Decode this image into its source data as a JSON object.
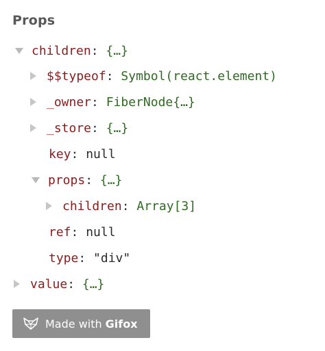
{
  "panel": {
    "title": "Props"
  },
  "tree": [
    {
      "id": "children",
      "key": "children",
      "value": "{…}",
      "vtype": "obj",
      "expander": "expanded"
    },
    {
      "id": "typeof",
      "key": "$$typeof",
      "value": "Symbol(react.element)",
      "vtype": "fn",
      "expander": "collapsed"
    },
    {
      "id": "owner",
      "key": "_owner",
      "value": "FiberNode{…}",
      "vtype": "fn",
      "expander": "collapsed"
    },
    {
      "id": "store",
      "key": "_store",
      "value": "{…}",
      "vtype": "obj",
      "expander": "collapsed"
    },
    {
      "id": "key",
      "key": "key",
      "value": "null",
      "vtype": "val",
      "expander": "none"
    },
    {
      "id": "props",
      "key": "props",
      "value": "{…}",
      "vtype": "obj",
      "expander": "expanded"
    },
    {
      "id": "props-children",
      "key": "children",
      "value": "Array[3]",
      "vtype": "fn",
      "expander": "collapsed"
    },
    {
      "id": "ref",
      "key": "ref",
      "value": "null",
      "vtype": "val",
      "expander": "none"
    },
    {
      "id": "type",
      "key": "type",
      "value": "\"div\"",
      "vtype": "val",
      "expander": "none"
    },
    {
      "id": "value",
      "key": "value",
      "value": "{…}",
      "vtype": "obj",
      "expander": "collapsed"
    }
  ],
  "watermark": {
    "prefix": "Made with",
    "brand": "Gifox",
    "icon": "fox-logo-icon"
  }
}
